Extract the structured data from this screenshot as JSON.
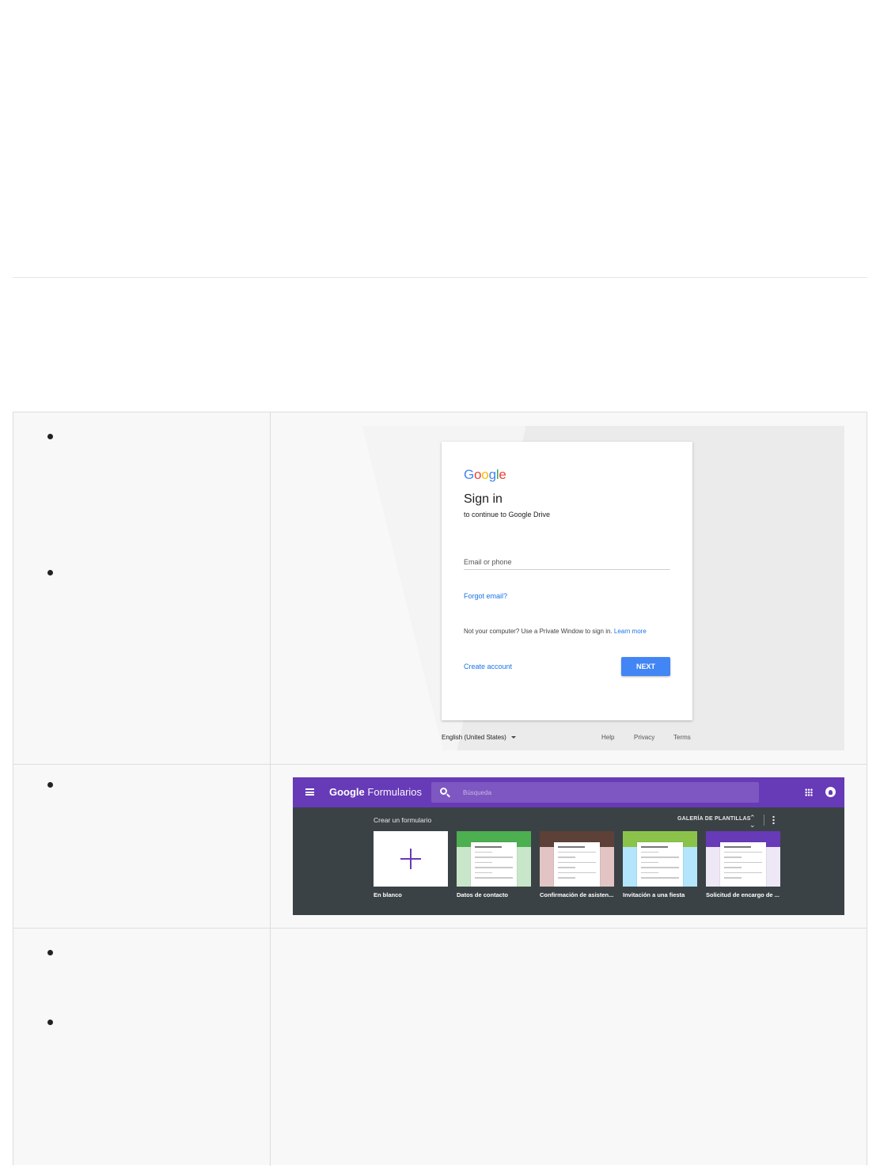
{
  "signin": {
    "logo": [
      {
        "char": "G",
        "color": "#4285F4"
      },
      {
        "char": "o",
        "color": "#EA4335"
      },
      {
        "char": "o",
        "color": "#FBBC05"
      },
      {
        "char": "g",
        "color": "#4285F4"
      },
      {
        "char": "l",
        "color": "#34A853"
      },
      {
        "char": "e",
        "color": "#EA4335"
      }
    ],
    "title": "Sign in",
    "subtitle": "to continue to Google Drive",
    "email_placeholder": "Email or phone",
    "forgot_email": "Forgot email?",
    "notice": "Not your computer? Use a Private Window to sign in.",
    "learn_more": "Learn more",
    "create_account": "Create account",
    "next_label": "NEXT",
    "language": "English (United States)",
    "footer": {
      "help": "Help",
      "privacy": "Privacy",
      "terms": "Terms"
    },
    "colors": {
      "primary": "#4285F4",
      "link": "#1A73E8"
    }
  },
  "forms": {
    "brand_google": "Google",
    "brand_product": "Formularios",
    "search_placeholder": "Búsqueda",
    "create_label": "Crear un formulario",
    "gallery_label": "GALERÍA DE PLANTILLAS",
    "templates": [
      {
        "name": "En blanco",
        "band_color": null,
        "bg_color": "#FFFFFF"
      },
      {
        "name": "Datos de contacto",
        "band_color": "#4CAF50",
        "bg_color": "#C8E6C9"
      },
      {
        "name": "Confirmación de asisten...",
        "band_color": "#5D4037",
        "bg_color": "#E3C4C4"
      },
      {
        "name": "Invitación a una fiesta",
        "band_color": "#8BC34A",
        "bg_color": "#B3E5FC"
      },
      {
        "name": "Solicitud de encargo de ...",
        "band_color": "#673AB7",
        "bg_color": "#EDE7F6"
      }
    ],
    "colors": {
      "header": "#673AB7",
      "search": "#7E57C2",
      "body": "#3B4245"
    }
  },
  "icons": [
    "menu-icon",
    "search-icon",
    "apps-icon",
    "account-icon",
    "expand-icon",
    "more-vert-icon",
    "plus-icon",
    "dropdown-caret-icon"
  ]
}
